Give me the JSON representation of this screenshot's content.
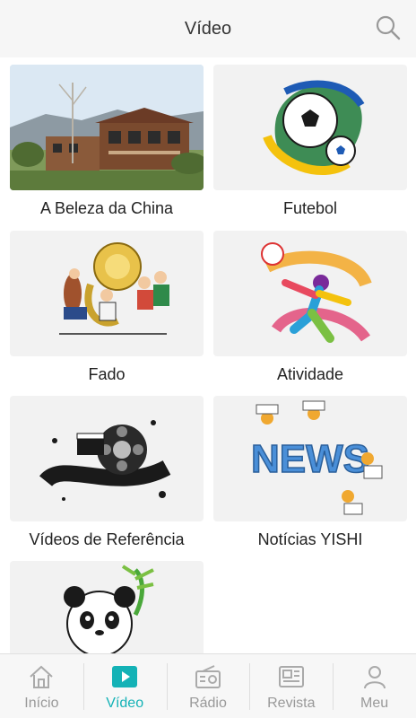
{
  "header": {
    "title": "Vídeo"
  },
  "icons": {
    "search": "search-icon"
  },
  "categories": [
    {
      "label": "A Beleza da China"
    },
    {
      "label": "Futebol"
    },
    {
      "label": "Fado"
    },
    {
      "label": "Atividade"
    },
    {
      "label": "Vídeos de Referência"
    },
    {
      "label": "Notícias YISHI"
    },
    {
      "label": ""
    }
  ],
  "tabs": [
    {
      "label": "Início",
      "icon": "home-icon"
    },
    {
      "label": "Vídeo",
      "icon": "video-play-icon",
      "active": true
    },
    {
      "label": "Rádio",
      "icon": "radio-icon"
    },
    {
      "label": "Revista",
      "icon": "magazine-icon"
    },
    {
      "label": "Meu",
      "icon": "user-icon"
    }
  ],
  "colors": {
    "accent": "#14b2b6",
    "inactive": "#999999",
    "header_bg": "#f6f6f6"
  }
}
